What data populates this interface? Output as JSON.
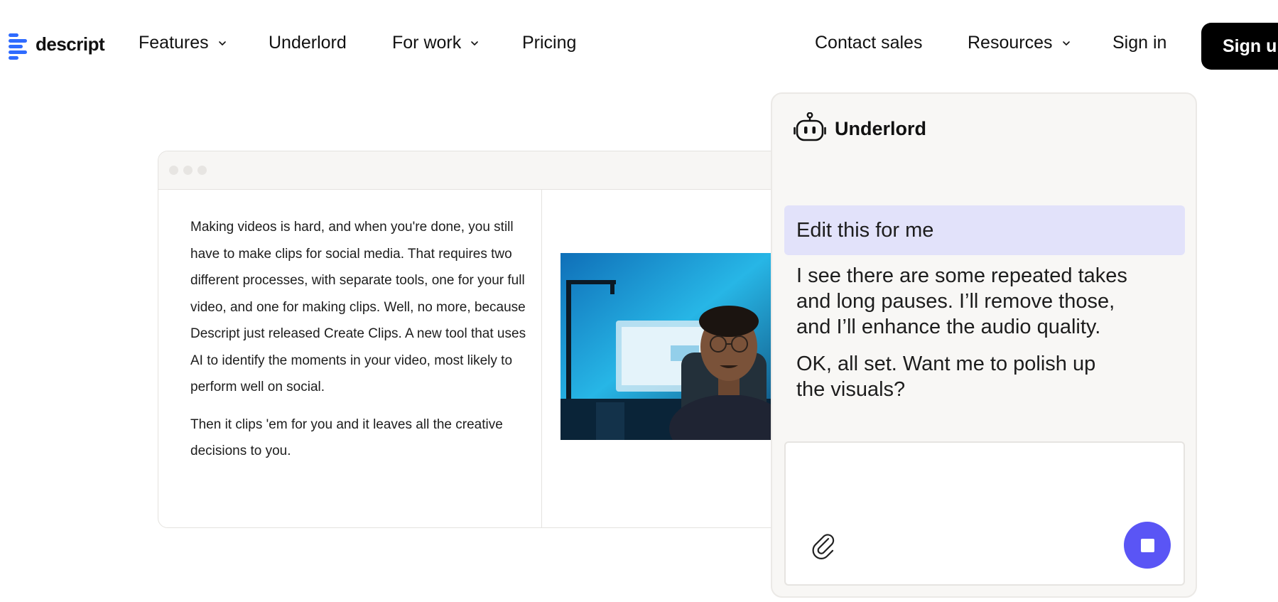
{
  "brand": {
    "name": "descript",
    "accent": "#2f6bff"
  },
  "nav": {
    "items": [
      {
        "label": "Features",
        "dropdown": true
      },
      {
        "label": "Underlord",
        "dropdown": false
      },
      {
        "label": "For work",
        "dropdown": true
      },
      {
        "label": "Pricing",
        "dropdown": false
      }
    ],
    "right": [
      {
        "label": "Contact sales",
        "dropdown": false
      },
      {
        "label": "Resources",
        "dropdown": true
      },
      {
        "label": "Sign in",
        "dropdown": false
      }
    ],
    "cta": "Sign up"
  },
  "editor": {
    "transcript": [
      "Making videos is hard, and when you're done, you still have to make clips for social media. That requires two different processes, with separate tools, one for your full video, and one for making clips. Well, no more, because Descript just released Create Clips. A new tool that uses AI to identify the moments in your video, most likely to perform well on social.",
      "Then it clips 'em for you and it leaves all the creative decisions to you."
    ]
  },
  "assistant": {
    "title": "Underlord",
    "icon": "robot-icon",
    "user_message": "Edit this for me",
    "replies": [
      "I see there are some repeated takes and long pauses. I’ll remove those, and I’ll enhance the audio quality.",
      "OK, all set. Want me to polish up the visuals?"
    ],
    "composer": {
      "placeholder": "",
      "attach_icon": "paperclip-icon",
      "stop_icon": "stop-icon",
      "stop_color": "#5a55f5"
    }
  }
}
